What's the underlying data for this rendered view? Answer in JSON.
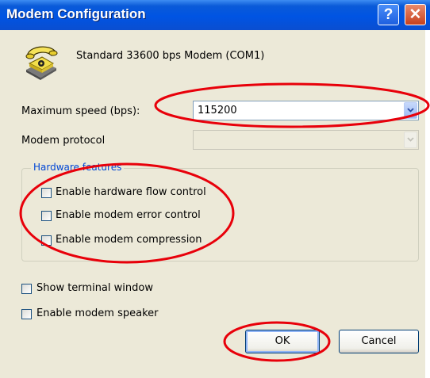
{
  "dialog": {
    "title": "Modem Configuration",
    "help_symbol": "?",
    "close_symbol": "✕",
    "modem_name": "Standard 33600 bps Modem (COM1)"
  },
  "fields": {
    "max_speed_label": "Maximum speed (bps):",
    "max_speed_value": "115200",
    "protocol_label": "Modem protocol",
    "protocol_value": ""
  },
  "hardware": {
    "title": "Hardware features",
    "options": [
      {
        "label": "Enable hardware flow control",
        "checked": false
      },
      {
        "label": "Enable modem error control",
        "checked": false
      },
      {
        "label": "Enable modem compression",
        "checked": false
      }
    ]
  },
  "extras": [
    {
      "label": "Show terminal window",
      "checked": false
    },
    {
      "label": "Enable modem speaker",
      "checked": false
    }
  ],
  "buttons": {
    "ok": "OK",
    "cancel": "Cancel"
  },
  "colors": {
    "titlebar": "#0054e3",
    "annotation": "#e8000a",
    "group_title": "#0046d5"
  },
  "icons": [
    "telephone-modem-icon",
    "help-icon",
    "close-icon",
    "chevron-down-icon"
  ]
}
